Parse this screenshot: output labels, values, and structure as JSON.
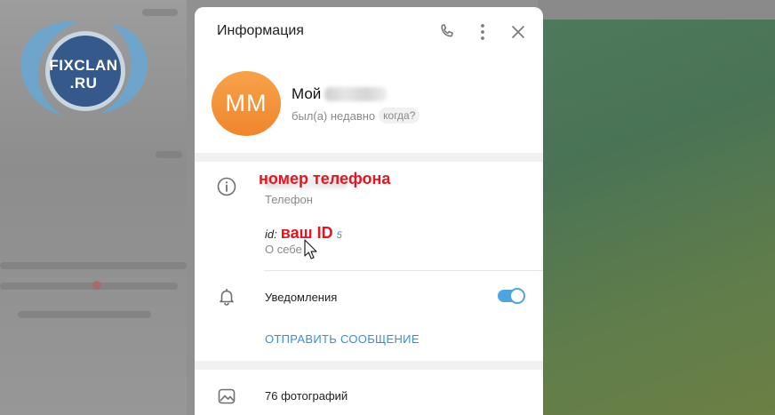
{
  "watermark": {
    "line1": "FIXCLAN",
    "line2": ".RU"
  },
  "panel": {
    "title": "Информация",
    "actions": [
      "phone-icon",
      "more-vertical-icon",
      "close-icon"
    ]
  },
  "profile": {
    "avatar_initials": "MM",
    "name": "Мой",
    "status": "был(а) недавно",
    "when_badge": "когда?"
  },
  "info": {
    "phone_annotation": "номер телефона",
    "phone_label": "Телефон",
    "bio_prefix": "id:",
    "id_annotation": "ваш ID",
    "id_tail": "5",
    "bio_label": "О себе"
  },
  "notifications": {
    "label": "Уведомления",
    "enabled": true
  },
  "send_message": {
    "label": "ОТПРАВИТЬ СООБЩЕНИЕ"
  },
  "media": {
    "photos_label": "76 фотографий"
  },
  "colors": {
    "accent": "#3a8fd0",
    "toggle": "#4ea4e0",
    "annotation": "#e8141f",
    "avatar": "#f0862e"
  }
}
